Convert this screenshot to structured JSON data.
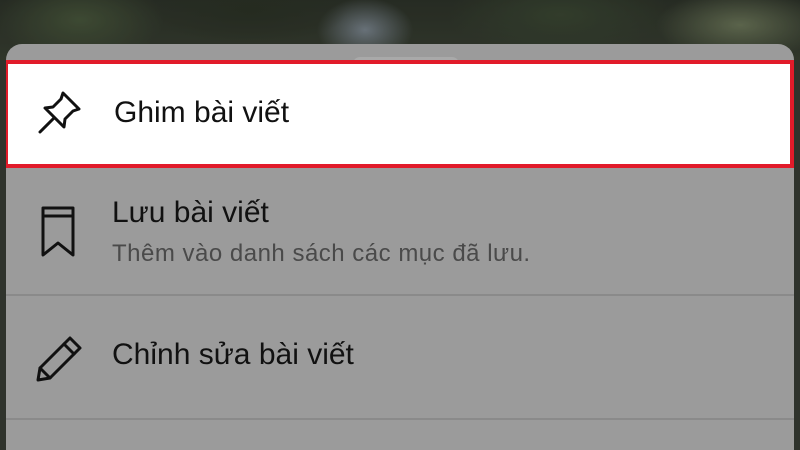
{
  "menu": {
    "items": [
      {
        "icon": "pin-icon",
        "label": "Ghim bài viết",
        "highlighted": true
      },
      {
        "icon": "bookmark-icon",
        "label": "Lưu bài viết",
        "description": "Thêm vào danh sách các mục đã lưu."
      },
      {
        "icon": "pencil-icon",
        "label": "Chỉnh sửa bài viết"
      }
    ]
  },
  "colors": {
    "highlight_border": "#e11b2a",
    "sheet_background": "#9b9b9b",
    "highlight_background": "#ffffff"
  }
}
